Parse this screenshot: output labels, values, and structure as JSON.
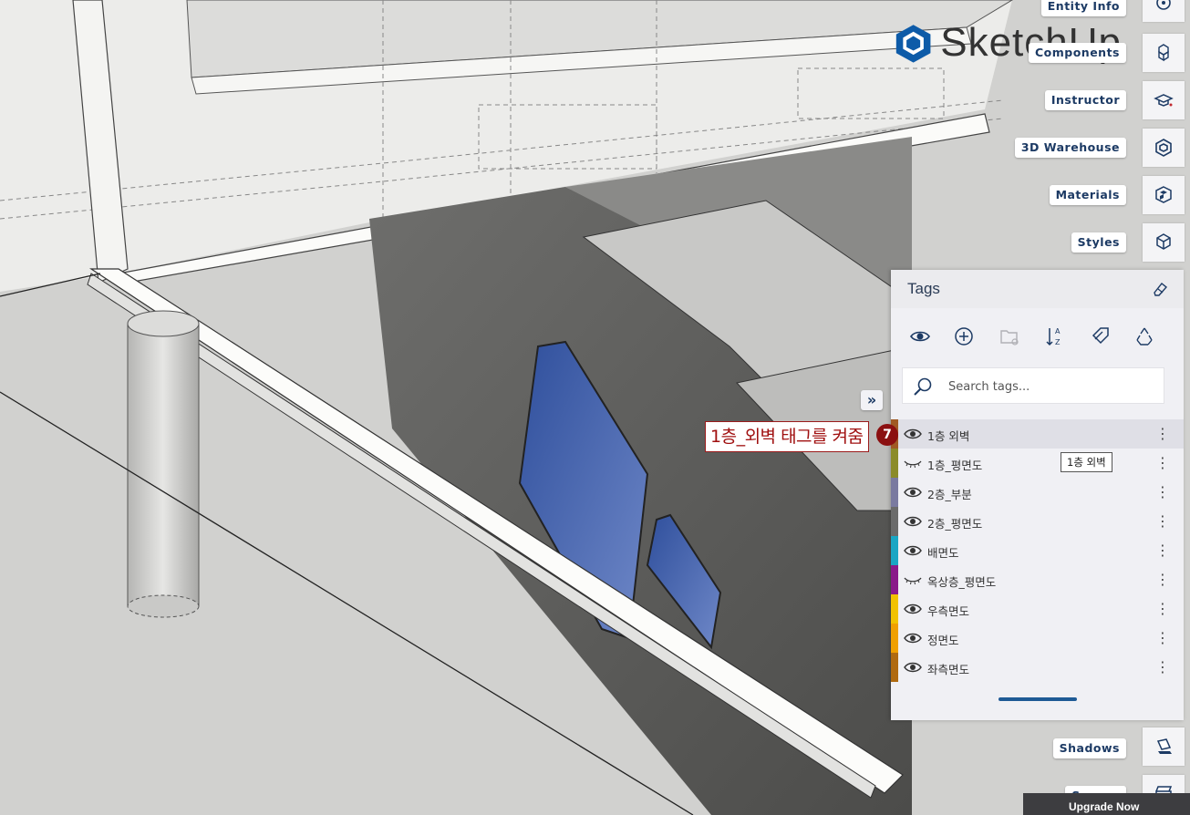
{
  "app": {
    "logo_text": "SketchUp"
  },
  "tray": {
    "items": [
      {
        "label": "Entity Info",
        "icon": "entity-info-icon"
      },
      {
        "label": "Components",
        "icon": "components-icon"
      },
      {
        "label": "Instructor",
        "icon": "instructor-icon"
      },
      {
        "label": "3D Warehouse",
        "icon": "3d-warehouse-icon"
      },
      {
        "label": "Materials",
        "icon": "materials-icon"
      },
      {
        "label": "Styles",
        "icon": "styles-icon"
      },
      {
        "label": "Shadows",
        "icon": "shadows-icon"
      },
      {
        "label": "Scenes",
        "icon": "scenes-icon"
      }
    ]
  },
  "tags_panel": {
    "title": "Tags",
    "search": {
      "placeholder": "Search tags..."
    },
    "toolbar": [
      "eye-icon",
      "add-tag-icon",
      "add-folder-icon",
      "sort-az-icon",
      "tag-tool-icon",
      "purge-icon"
    ],
    "tags": [
      {
        "name": "1층 외벽",
        "visible": true,
        "color": "#a05a24",
        "selected": true
      },
      {
        "name": "1층_평면도",
        "visible": false,
        "color": "#8b8b2a",
        "selected": false
      },
      {
        "name": "2층_부분",
        "visible": true,
        "color": "#7a7aa0",
        "selected": false
      },
      {
        "name": "2층_평면도",
        "visible": true,
        "color": "#6b6b6b",
        "selected": false
      },
      {
        "name": "배면도",
        "visible": true,
        "color": "#1aa6c4",
        "selected": false
      },
      {
        "name": "옥상층_평면도",
        "visible": false,
        "color": "#8a1a8a",
        "selected": false
      },
      {
        "name": "우측면도",
        "visible": true,
        "color": "#f2c200",
        "selected": false
      },
      {
        "name": "정면도",
        "visible": true,
        "color": "#f0a000",
        "selected": false
      },
      {
        "name": "좌측면도",
        "visible": true,
        "color": "#b06a10",
        "selected": false
      }
    ],
    "tooltip": "1층 외벽"
  },
  "annotation": {
    "text": "1층_외벽 태그를 켜줌",
    "step": "7"
  },
  "upgrade": {
    "label": "Upgrade Now"
  },
  "colors": {
    "accent": "#1e5a95",
    "tray_text": "#1c3a64",
    "annotation": "#9b1b1b"
  }
}
